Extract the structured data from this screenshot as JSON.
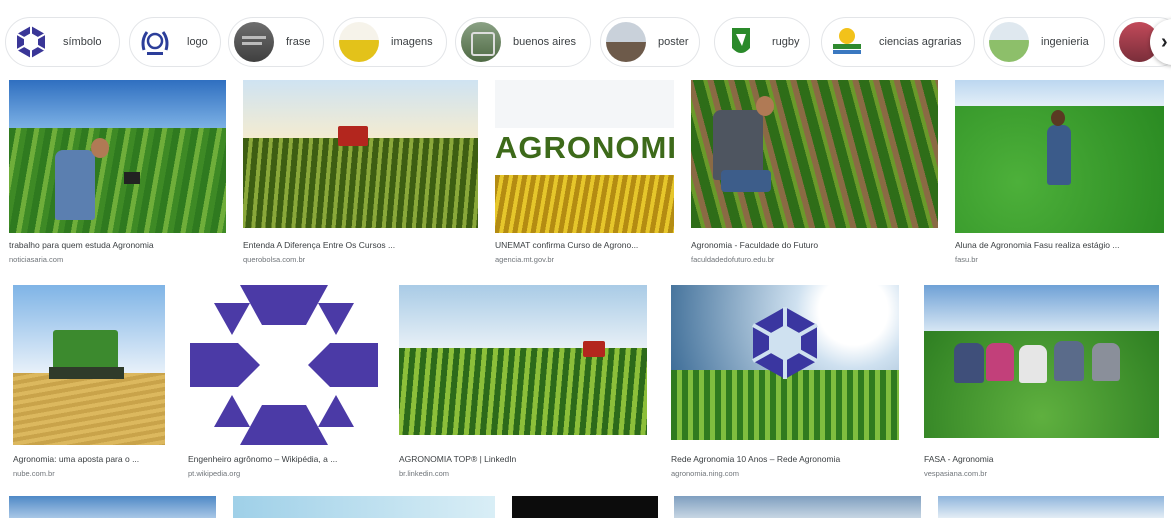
{
  "chips": [
    {
      "label": "símbolo",
      "thumb": "logo-star-icon"
    },
    {
      "label": "logo",
      "thumb": "laurel-logo-icon"
    },
    {
      "label": "frase",
      "thumb": "photo-thumb"
    },
    {
      "label": "imagens",
      "thumb": "photo-thumb"
    },
    {
      "label": "buenos aires",
      "thumb": "photo-thumb"
    },
    {
      "label": "poster",
      "thumb": "photo-thumb"
    },
    {
      "label": "rugby",
      "thumb": "rugby-logo-icon"
    },
    {
      "label": "ciencias agrarias",
      "thumb": "logo-thumb"
    },
    {
      "label": "ingenieria",
      "thumb": "photo-thumb"
    }
  ],
  "chips_next_icon": "chevron-right-icon",
  "chips_next_glyph": "›",
  "results_row1": [
    {
      "title": "trabalho para quem estuda Agronomia",
      "source": "noticiasaria.com"
    },
    {
      "title": "Entenda A Diferença Entre Os Cursos ...",
      "source": "querobolsa.com.br"
    },
    {
      "title": "UNEMAT confirma Curso de Agrono...",
      "source": "agencia.mt.gov.br"
    },
    {
      "title": "Agronomia - Faculdade do Futuro",
      "source": "faculdadedofuturo.edu.br"
    },
    {
      "title": "Aluna de Agronomia Fasu realiza estágio ...",
      "source": "fasu.br"
    }
  ],
  "results_row2": [
    {
      "title": "Agronomia: uma aposta para o ...",
      "source": "nube.com.br"
    },
    {
      "title": "Engenheiro agrônomo – Wikipédia, a ...",
      "source": "pt.wikipedia.org"
    },
    {
      "title": "AGRONOMIA TOP® | LinkedIn",
      "source": "br.linkedin.com"
    },
    {
      "title": "Rede Agronomia 10 Anos – Rede Agronomia",
      "source": "agronomia.ning.com"
    },
    {
      "title": "FASA - Agronomia",
      "source": "vespasiana.com.br"
    }
  ],
  "agronomia_banner_text": "AGRONOMIA"
}
